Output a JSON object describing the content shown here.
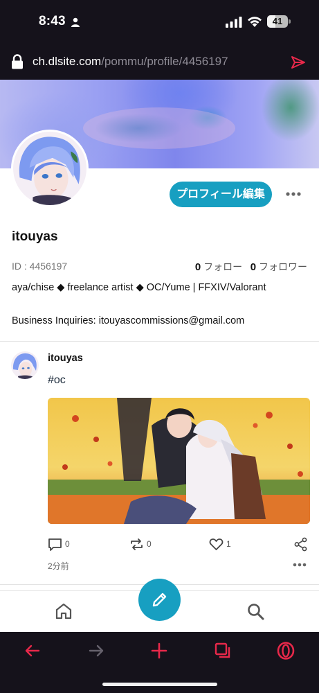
{
  "status_bar": {
    "time": "8:43",
    "battery": "41",
    "battery_level": 0.41
  },
  "browser": {
    "url_domain": "ch.dlsite.com",
    "url_path": "/pommu/profile/4456197",
    "accent": "#e8284a"
  },
  "profile": {
    "edit_button": "プロフィール編集",
    "name": "itouyas",
    "id_label": "ID : 4456197",
    "follow_count": "0",
    "follow_label": "フォロー",
    "follower_count": "0",
    "follower_label": "フォロワー",
    "bio_line1": "aya/chise ◆ freelance artist ◆ OC/Yume | FFXIV/Valorant",
    "bio_line2": "Business Inquiries: itouyascommissions@gmail.com"
  },
  "post": {
    "author": "itouyas",
    "text": "#oc",
    "comments": "0",
    "reposts": "0",
    "likes": "1",
    "time": "2分前"
  },
  "colors": {
    "brand": "#179fc1",
    "dark_bar": "#15121b"
  },
  "icons": [
    "person-icon",
    "signal-icon",
    "wifi-icon",
    "lock-icon",
    "send-icon",
    "more-icon",
    "comment-icon",
    "repost-icon",
    "heart-icon",
    "share-icon",
    "home-icon",
    "search-icon",
    "pencil-icon",
    "back-icon",
    "forward-icon",
    "plus-icon",
    "tabs-icon",
    "opera-icon"
  ]
}
